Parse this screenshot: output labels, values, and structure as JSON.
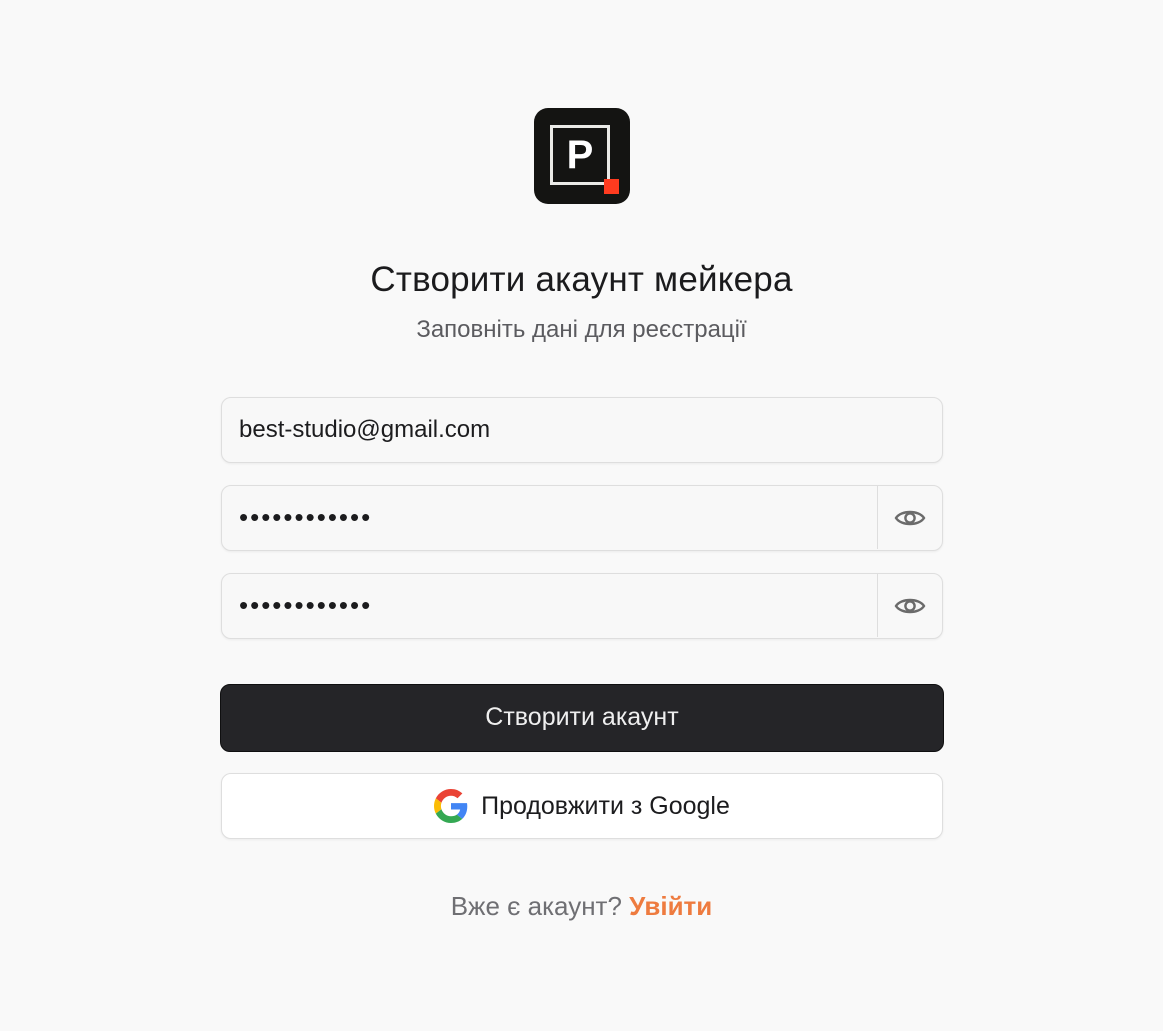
{
  "brand": {
    "logo_letter": "P",
    "accent_color": "#ff3b1f"
  },
  "header": {
    "title": "Створити акаунт мейкера",
    "subtitle": "Заповніть дані для реєстрації"
  },
  "form": {
    "email": {
      "value": "best-studio@gmail.com",
      "icon": null
    },
    "password": {
      "value": "••••••••••••",
      "toggle_icon": "eye-icon"
    },
    "confirm_password": {
      "value": "••••••••••••",
      "toggle_icon": "eye-icon"
    },
    "submit_label": "Створити акаунт",
    "google_label": "Продовжити з Google",
    "google_icon": "google-icon"
  },
  "footer": {
    "question": "Вже є акаунт?",
    "login_link": "Увійти",
    "link_color": "#ee7b3f"
  }
}
